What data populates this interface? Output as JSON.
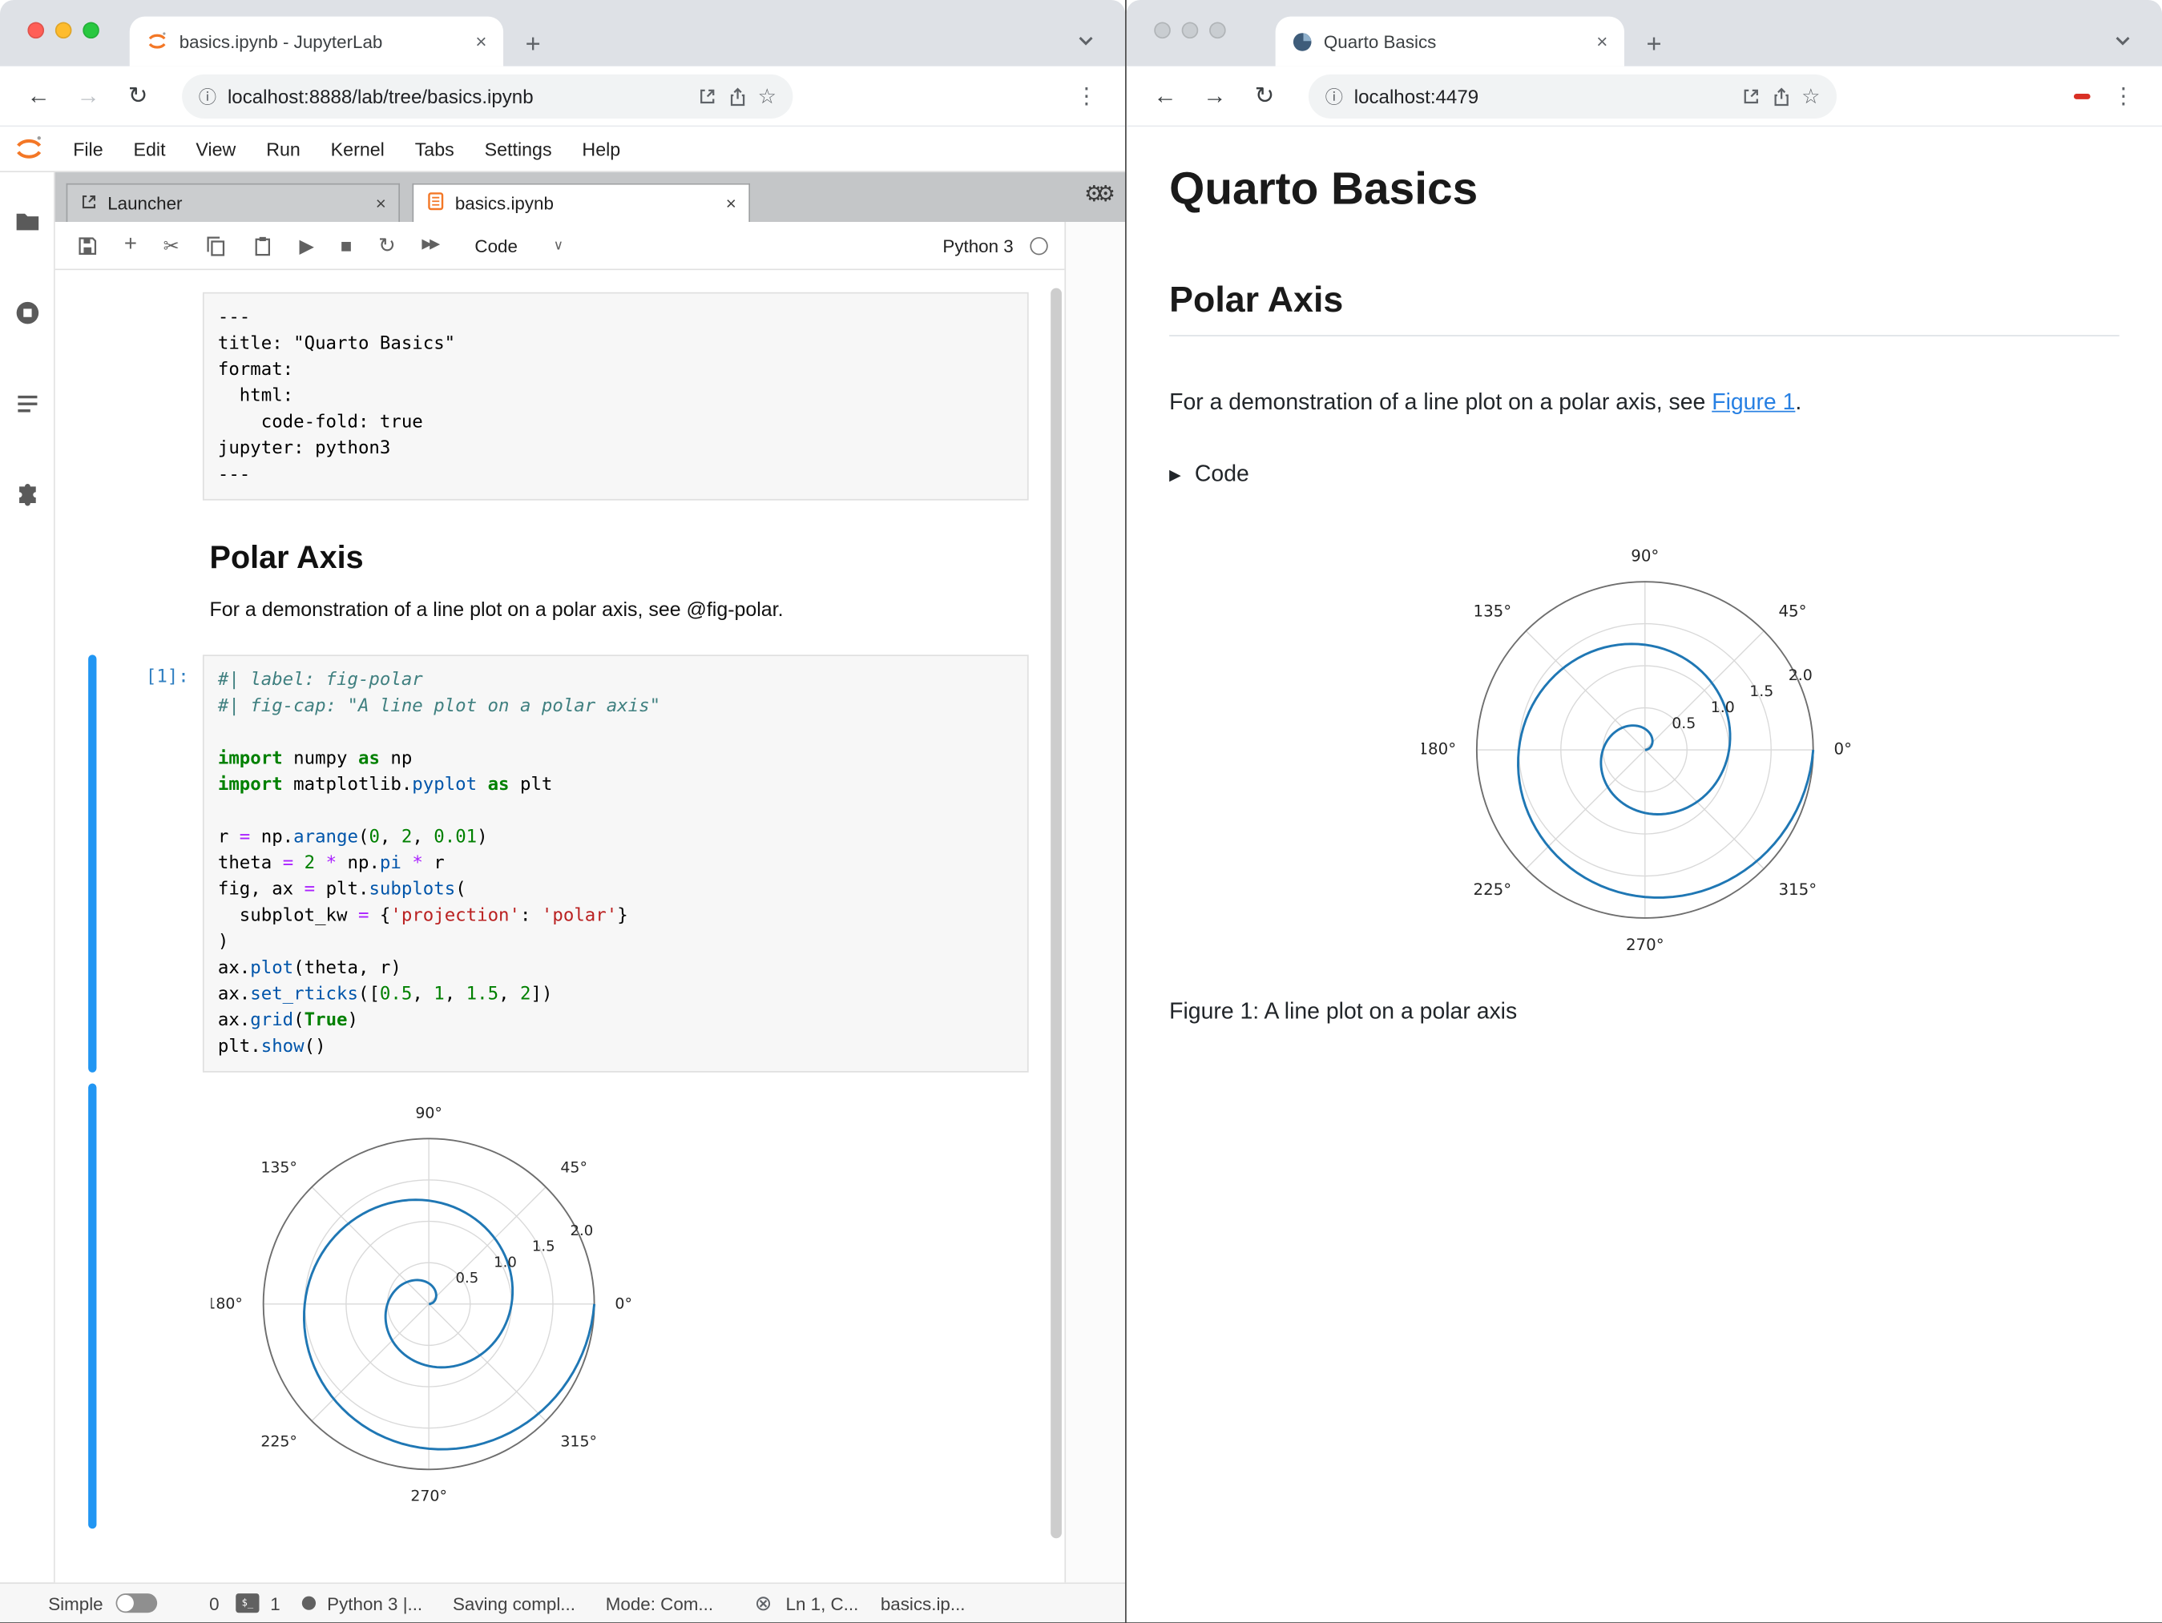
{
  "icons": {
    "close": "×",
    "newtab": "+",
    "back": "←",
    "forward": "→",
    "reload": "↻",
    "info": "ⓘ",
    "star": "☆",
    "more": "⋮",
    "scissors": "✂",
    "run": "▶",
    "stop": "■",
    "restart": "↻",
    "fastforward": "▶▶",
    "dropdown": "∨",
    "gears": "⚙⚙",
    "caret_right": "▶",
    "terminal_badge": "$_",
    "status_x": "⊗",
    "launcher_glyph": "⊞"
  },
  "left_window": {
    "tab_title": "basics.ipynb - JupyterLab",
    "url": "localhost:8888/lab/tree/basics.ipynb",
    "menu": {
      "file": "File",
      "edit": "Edit",
      "view": "View",
      "run": "Run",
      "kernel": "Kernel",
      "tabs": "Tabs",
      "settings": "Settings",
      "help": "Help"
    },
    "dock": {
      "launcher_tab": "Launcher",
      "notebook_tab": "basics.ipynb"
    },
    "toolbar": {
      "cell_type": "Code",
      "kernel_name": "Python 3"
    },
    "notebook": {
      "raw_cell_lines": [
        "---",
        "title: \"Quarto Basics\"",
        "format:",
        "  html:",
        "    code-fold: true",
        "jupyter: python3",
        "---"
      ],
      "md_heading": "Polar Axis",
      "md_paragraph": "For a demonstration of a line plot on a polar axis, see @fig-polar.",
      "code_prompt": "[1]:",
      "code_lines": [
        [
          {
            "t": "#| label: fig-polar",
            "c": "c"
          }
        ],
        [
          {
            "t": "#| fig-cap: \"A line plot on a polar axis\"",
            "c": "c"
          }
        ],
        [],
        [
          {
            "t": "import",
            "c": "k"
          },
          {
            "t": " numpy "
          },
          {
            "t": "as",
            "c": "k"
          },
          {
            "t": " np"
          }
        ],
        [
          {
            "t": "import",
            "c": "k"
          },
          {
            "t": " matplotlib."
          },
          {
            "t": "pyplot",
            "c": "p"
          },
          {
            "t": " "
          },
          {
            "t": "as",
            "c": "k"
          },
          {
            "t": " plt"
          }
        ],
        [],
        [
          {
            "t": "r "
          },
          {
            "t": "=",
            "c": "o"
          },
          {
            "t": " np."
          },
          {
            "t": "arange",
            "c": "p"
          },
          {
            "t": "("
          },
          {
            "t": "0",
            "c": "n"
          },
          {
            "t": ", "
          },
          {
            "t": "2",
            "c": "n"
          },
          {
            "t": ", "
          },
          {
            "t": "0.01",
            "c": "n"
          },
          {
            "t": ")"
          }
        ],
        [
          {
            "t": "theta "
          },
          {
            "t": "=",
            "c": "o"
          },
          {
            "t": " "
          },
          {
            "t": "2",
            "c": "n"
          },
          {
            "t": " "
          },
          {
            "t": "*",
            "c": "o"
          },
          {
            "t": " np."
          },
          {
            "t": "pi",
            "c": "p"
          },
          {
            "t": " "
          },
          {
            "t": "*",
            "c": "o"
          },
          {
            "t": " r"
          }
        ],
        [
          {
            "t": "fig, ax "
          },
          {
            "t": "=",
            "c": "o"
          },
          {
            "t": " plt."
          },
          {
            "t": "subplots",
            "c": "p"
          },
          {
            "t": "("
          }
        ],
        [
          {
            "t": "  subplot_kw "
          },
          {
            "t": "=",
            "c": "o"
          },
          {
            "t": " {"
          },
          {
            "t": "'projection'",
            "c": "s"
          },
          {
            "t": ": "
          },
          {
            "t": "'polar'",
            "c": "s"
          },
          {
            "t": "}"
          }
        ],
        [
          {
            "t": ")"
          }
        ],
        [
          {
            "t": "ax."
          },
          {
            "t": "plot",
            "c": "p"
          },
          {
            "t": "(theta, r)"
          }
        ],
        [
          {
            "t": "ax."
          },
          {
            "t": "set_rticks",
            "c": "p"
          },
          {
            "t": "(["
          },
          {
            "t": "0.5",
            "c": "n"
          },
          {
            "t": ", "
          },
          {
            "t": "1",
            "c": "n"
          },
          {
            "t": ", "
          },
          {
            "t": "1.5",
            "c": "n"
          },
          {
            "t": ", "
          },
          {
            "t": "2",
            "c": "n"
          },
          {
            "t": "])"
          }
        ],
        [
          {
            "t": "ax."
          },
          {
            "t": "grid",
            "c": "p"
          },
          {
            "t": "("
          },
          {
            "t": "True",
            "c": "k"
          },
          {
            "t": ")"
          }
        ],
        [
          {
            "t": "plt."
          },
          {
            "t": "show",
            "c": "p"
          },
          {
            "t": "()"
          }
        ]
      ]
    },
    "statusbar": {
      "simple": "Simple",
      "terminals_count": "0",
      "kernels_count": "1",
      "kernel_status": "Python 3 |...",
      "saving": "Saving compl...",
      "mode": "Mode: Com...",
      "position": "Ln 1, C...",
      "filename": "basics.ip..."
    }
  },
  "right_window": {
    "tab_title": "Quarto Basics",
    "url": "localhost:4479",
    "page": {
      "title": "Quarto Basics",
      "section": "Polar Axis",
      "para_before_link": "For a demonstration of a line plot on a polar axis, see ",
      "link_text": "Figure 1",
      "para_after_link": ".",
      "code_toggle": "Code",
      "caption": "Figure 1: A line plot on a polar axis"
    }
  },
  "chart_data": {
    "type": "line",
    "projection": "polar",
    "description": "Archimedean spiral: r from 0 to 2 in steps of 0.01, theta = 2*pi*r (two full turns)",
    "r_range": [
      0,
      2
    ],
    "r_step": 0.01,
    "theta_formula": "2 * pi * r",
    "rticks": [
      0.5,
      1.0,
      1.5,
      2.0
    ],
    "rtick_labels": [
      "0.5",
      "1.0",
      "1.5",
      "2.0"
    ],
    "rlabel_angle_deg": 22.5,
    "angle_ticks_deg": [
      0,
      45,
      90,
      135,
      180,
      225,
      270,
      315
    ],
    "angle_labels": [
      "0°",
      "45°",
      "90°",
      "135°",
      "180°",
      "225°",
      "270°",
      "315°"
    ],
    "line_color": "#1f77b4",
    "grid": true,
    "grid_color": "#d9d9d9",
    "spine_color": "#6e6e6e"
  }
}
